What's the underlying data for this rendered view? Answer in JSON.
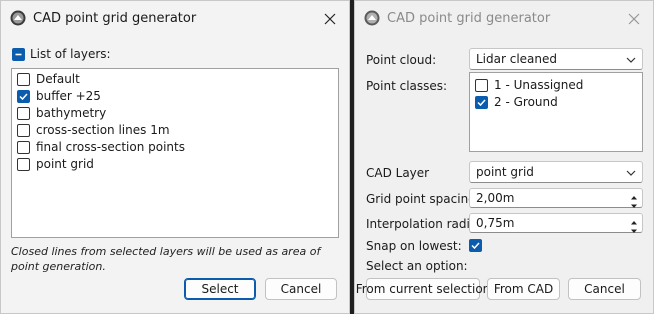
{
  "left_window": {
    "title": "CAD point grid generator",
    "list_header": "List of layers:",
    "layers": [
      {
        "label": "Default",
        "checked": false
      },
      {
        "label": "buffer +25",
        "checked": true
      },
      {
        "label": "bathymetry",
        "checked": false
      },
      {
        "label": "cross-section lines 1m",
        "checked": false
      },
      {
        "label": "final cross-section points",
        "checked": false
      },
      {
        "label": "point grid",
        "checked": false
      }
    ],
    "hint": "Closed lines from selected layers will be used as area of point generation.",
    "select_label": "Select",
    "cancel_label": "Cancel"
  },
  "right_window": {
    "title": "CAD point grid generator",
    "point_cloud_label": "Point cloud:",
    "point_cloud_value": "Lidar cleaned",
    "point_classes_label": "Point classes:",
    "classes": [
      {
        "label": "1 - Unassigned",
        "checked": false
      },
      {
        "label": "2 - Ground",
        "checked": true
      }
    ],
    "cad_layer_label": "CAD Layer",
    "cad_layer_value": "point grid",
    "grid_spacing_label": "Grid point spacing:",
    "grid_spacing_value": "2,00m",
    "interp_radius_label": "Interpolation radius:",
    "interp_radius_value": "0,75m",
    "snap_label": "Snap on lowest:",
    "snap_checked": true,
    "select_option_label": "Select an option:",
    "from_selection_label": "From current selection",
    "from_cad_label": "From CAD",
    "cancel_label": "Cancel"
  },
  "colors": {
    "accent": "#0b5cad",
    "background": "#f3f3f3",
    "title_disabled": "#8a8a8a"
  },
  "icons": [
    "app-icon",
    "close-icon",
    "checkbox-checked",
    "checkbox-partial",
    "chevron-down-icon",
    "spin-up-icon",
    "spin-down-icon"
  ]
}
